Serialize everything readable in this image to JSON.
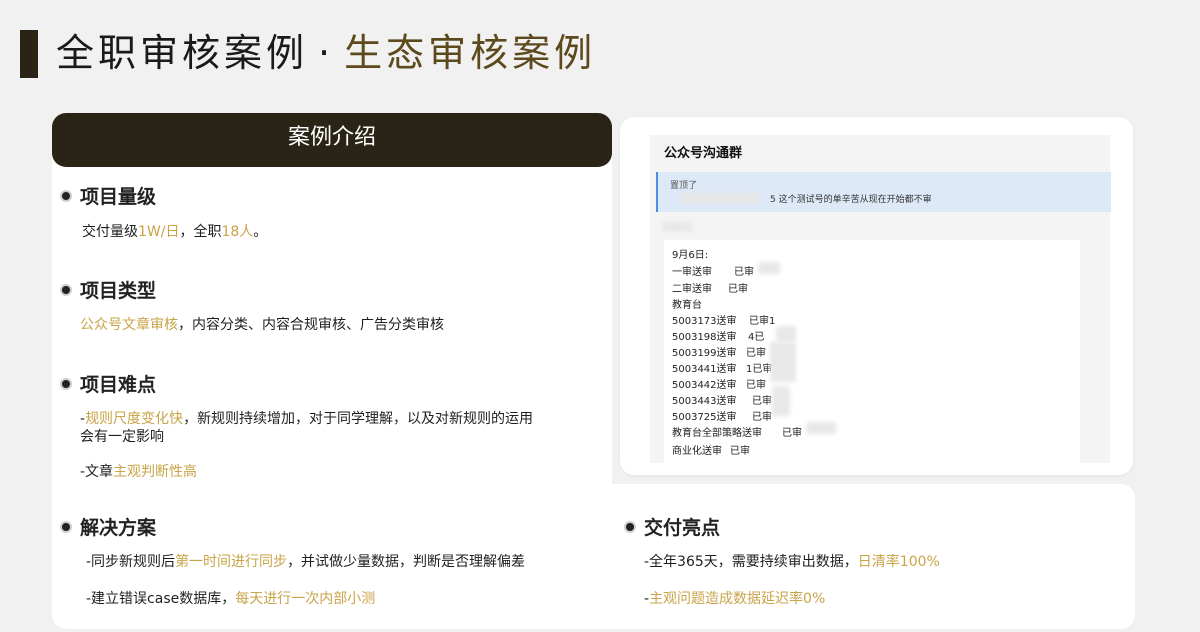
{
  "header": {
    "title_main": "全职审核案例",
    "title_sep": "·",
    "title_sub": "生态审核案例"
  },
  "intro": {
    "label": "案例介绍"
  },
  "sections": {
    "scale": {
      "heading": "项目量级",
      "l1_a": "交付量级",
      "l1_b": "1W/日",
      "l1_c": "，全职",
      "l1_d": "18人",
      "l1_e": "。"
    },
    "type": {
      "heading": "项目类型",
      "l1_a": "公众号文章审核",
      "l1_b": "，内容分类、内容合规审核、广告分类审核"
    },
    "difficulty": {
      "heading": "项目难点",
      "l1_a": "-",
      "l1_b": "规则尺度变化快",
      "l1_c": "，新规则持续增加，对于同学理解，以及对新规则的运用",
      "l2": "会有一定影响",
      "l3_a": "-文章",
      "l3_b": "主观判断性高"
    },
    "solution": {
      "heading": "解决方案",
      "l1_a": "-同步新规则后",
      "l1_b": "第一时间进行同步",
      "l1_c": "，并试做少量数据，判断是否理解偏差",
      "l2_a": "-建立错误case数据库，",
      "l2_b": "每天进行一次内部小测"
    },
    "highlight": {
      "heading": "交付亮点",
      "l1_a": "-全年365天，需要持续审出数据，",
      "l1_b": "日清率100%",
      "l2_a": "-",
      "l2_b": "主观问题造成数据延迟率0%"
    }
  },
  "screenshot": {
    "group_name": "公众号沟通群",
    "pin_top": "置顶了",
    "pin_msg": "5 这个测试号的单辛苦从现在开始都不审",
    "lines": [
      "9月6日:",
      "一审送审",
      "二审送审",
      "教育台",
      "5003173送审",
      "5003198送审",
      "5003199送审",
      "5003441送审",
      "5003442送审",
      "5003443送审",
      "5003725送审",
      "教育台全部策略送审",
      "商业化送审"
    ],
    "partials": {
      "p1": "已审",
      "p2": "已审",
      "p3": "已审1",
      "p4": "4已",
      "p5": "已审",
      "p6": "1已审1",
      "p7": "已审",
      "p8": "已审",
      "p9": "已审",
      "p10": "已审",
      "p11": "已审"
    }
  }
}
